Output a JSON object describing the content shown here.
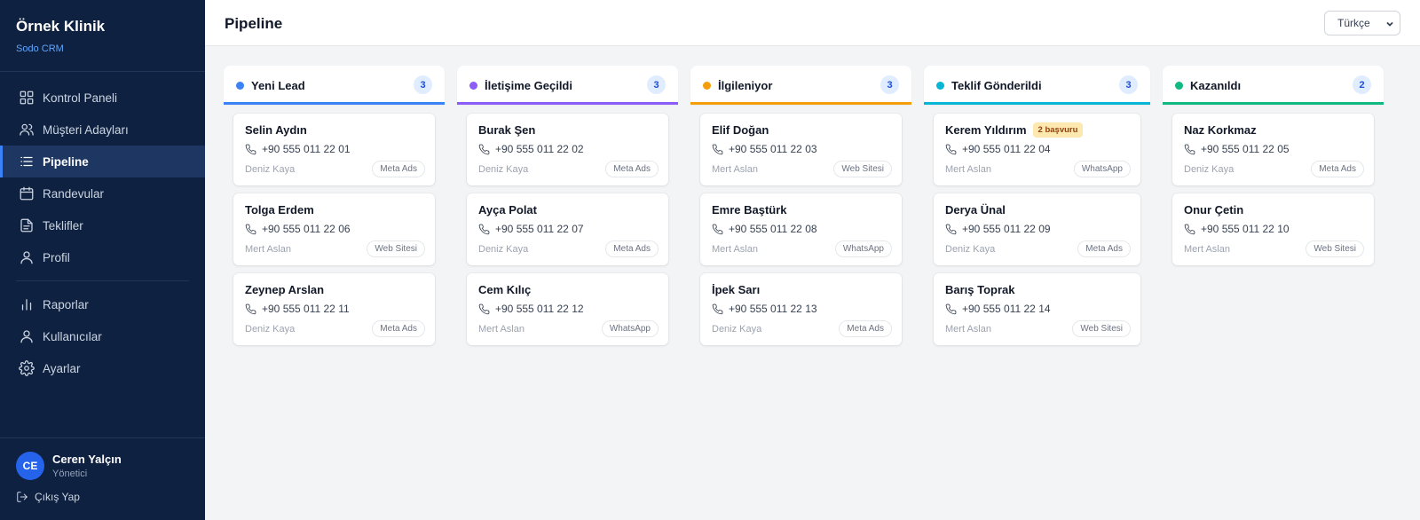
{
  "brand": {
    "title": "Örnek Klinik",
    "subtitle": "Sodo CRM"
  },
  "nav": {
    "items": [
      {
        "label": "Kontrol Paneli",
        "icon": "dashboard-icon"
      },
      {
        "label": "Müşteri Adayları",
        "icon": "users-icon"
      },
      {
        "label": "Pipeline",
        "icon": "list-icon",
        "active": true
      },
      {
        "label": "Randevular",
        "icon": "calendar-icon"
      },
      {
        "label": "Teklifler",
        "icon": "document-icon"
      },
      {
        "label": "Profil",
        "icon": "user-icon"
      }
    ],
    "admin_items": [
      {
        "label": "Raporlar",
        "icon": "bar-chart-icon"
      },
      {
        "label": "Kullanıcılar",
        "icon": "user-icon"
      },
      {
        "label": "Ayarlar",
        "icon": "gear-icon"
      }
    ]
  },
  "user": {
    "initials": "CE",
    "name": "Ceren Yalçın",
    "role": "Yönetici",
    "logout": "Çıkış Yap"
  },
  "header": {
    "title": "Pipeline",
    "language": "Türkçe"
  },
  "colors": {
    "sidebar": "#0f2141",
    "accent": "#3b82f6"
  },
  "columns": [
    {
      "title": "Yeni Lead",
      "count": "3",
      "color": "#3b82f6",
      "cards": [
        {
          "name": "Selin Aydın",
          "phone": "+90 555 011 22 01",
          "owner": "Deniz Kaya",
          "source": "Meta Ads"
        },
        {
          "name": "Tolga Erdem",
          "phone": "+90 555 011 22 06",
          "owner": "Mert Aslan",
          "source": "Web Sitesi"
        },
        {
          "name": "Zeynep Arslan",
          "phone": "+90 555 011 22 11",
          "owner": "Deniz Kaya",
          "source": "Meta Ads"
        }
      ]
    },
    {
      "title": "İletişime Geçildi",
      "count": "3",
      "color": "#8b5cf6",
      "cards": [
        {
          "name": "Burak Şen",
          "phone": "+90 555 011 22 02",
          "owner": "Deniz Kaya",
          "source": "Meta Ads"
        },
        {
          "name": "Ayça Polat",
          "phone": "+90 555 011 22 07",
          "owner": "Deniz Kaya",
          "source": "Meta Ads"
        },
        {
          "name": "Cem Kılıç",
          "phone": "+90 555 011 22 12",
          "owner": "Mert Aslan",
          "source": "WhatsApp"
        }
      ]
    },
    {
      "title": "İlgileniyor",
      "count": "3",
      "color": "#f59e0b",
      "cards": [
        {
          "name": "Elif Doğan",
          "phone": "+90 555 011 22 03",
          "owner": "Mert Aslan",
          "source": "Web Sitesi"
        },
        {
          "name": "Emre Baştürk",
          "phone": "+90 555 011 22 08",
          "owner": "Mert Aslan",
          "source": "WhatsApp"
        },
        {
          "name": "İpek Sarı",
          "phone": "+90 555 011 22 13",
          "owner": "Deniz Kaya",
          "source": "Meta Ads"
        }
      ]
    },
    {
      "title": "Teklif Gönderildi",
      "count": "3",
      "color": "#06b6d4",
      "cards": [
        {
          "name": "Kerem Yıldırım",
          "badge": "2 başvuru",
          "phone": "+90 555 011 22 04",
          "owner": "Mert Aslan",
          "source": "WhatsApp"
        },
        {
          "name": "Derya Ünal",
          "phone": "+90 555 011 22 09",
          "owner": "Deniz Kaya",
          "source": "Meta Ads"
        },
        {
          "name": "Barış Toprak",
          "phone": "+90 555 011 22 14",
          "owner": "Mert Aslan",
          "source": "Web Sitesi"
        }
      ]
    },
    {
      "title": "Kazanıldı",
      "count": "2",
      "color": "#10b981",
      "cards": [
        {
          "name": "Naz Korkmaz",
          "phone": "+90 555 011 22 05",
          "owner": "Deniz Kaya",
          "source": "Meta Ads"
        },
        {
          "name": "Onur Çetin",
          "phone": "+90 555 011 22 10",
          "owner": "Mert Aslan",
          "source": "Web Sitesi"
        }
      ]
    }
  ]
}
